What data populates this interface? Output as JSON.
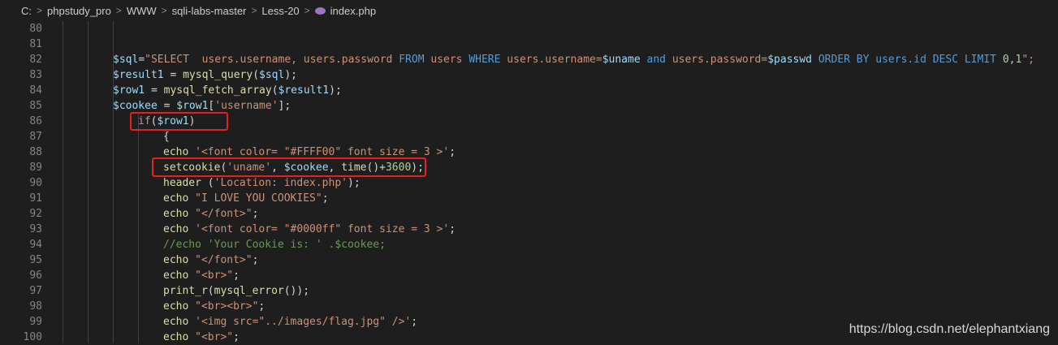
{
  "breadcrumb": [
    "C:",
    "phpstudy_pro",
    "WWW",
    "sqli-labs-master",
    "Less-20",
    "index.php"
  ],
  "icons": {
    "separator": "chevron-right-icon",
    "file": "php-elephant-icon"
  },
  "line_numbers": [
    "80",
    "81",
    "82",
    "83",
    "84",
    "85",
    "86",
    "87",
    "88",
    "89",
    "90",
    "91",
    "92",
    "93",
    "94",
    "95",
    "96",
    "97",
    "98",
    "99",
    "100"
  ],
  "code": {
    "l82": {
      "a": "$sql",
      "b": "=",
      "c": "\"SELECT  users.username, users.password ",
      "d": "FROM",
      "e": " users ",
      "f": "WHERE",
      "g": " users.username=",
      "h": "$uname",
      "i": " and ",
      "j": "users.password=",
      "k": "$passwd",
      "l": " ORDER BY users.id DESC LIMIT ",
      "m": "0,1",
      "n": "\";"
    },
    "l83": {
      "a": "$result1",
      "b": " = ",
      "c": "mysql_query",
      "d": "(",
      "e": "$sql",
      "f": ");"
    },
    "l84": {
      "a": "$row1",
      "b": " = ",
      "c": "mysql_fetch_array",
      "d": "(",
      "e": "$result1",
      "f": ");"
    },
    "l85": {
      "a": "$cookee",
      "b": " = ",
      "c": "$row1",
      "d": "[",
      "e": "'username'",
      "f": "];"
    },
    "l86": {
      "a": "if",
      "b": "(",
      "c": "$row1",
      "d": ")"
    },
    "l87": {
      "a": "{"
    },
    "l88": {
      "a": "echo ",
      "b": "'<font color= \"#FFFF00\" font size = 3 >'",
      "c": ";"
    },
    "l89": {
      "a": "setcookie",
      "b": "(",
      "c": "'uname'",
      "d": ", ",
      "e": "$cookee",
      "f": ", ",
      "g": "time",
      "h": "()+",
      "i": "3600",
      "j": ");"
    },
    "l90": {
      "a": "header ",
      "b": "(",
      "c": "'Location: index.php'",
      "d": ");"
    },
    "l91": {
      "a": "echo ",
      "b": "\"I LOVE YOU COOKIES\"",
      "c": ";"
    },
    "l92": {
      "a": "echo ",
      "b": "\"</font>\"",
      "c": ";"
    },
    "l93": {
      "a": "echo ",
      "b": "'<font color= \"#0000ff\" font size = 3 >'",
      "c": ";"
    },
    "l94": {
      "a": "//echo 'Your Cookie is: ' .$cookee;"
    },
    "l95": {
      "a": "echo ",
      "b": "\"</font>\"",
      "c": ";"
    },
    "l96": {
      "a": "echo ",
      "b": "\"<br>\"",
      "c": ";"
    },
    "l97": {
      "a": "print_r",
      "b": "(",
      "c": "mysql_error",
      "d": "());"
    },
    "l98": {
      "a": "echo ",
      "b": "\"<br><br>\"",
      "c": ";"
    },
    "l99": {
      "a": "echo ",
      "b": "'<img src=\"../images/flag.jpg\" />'",
      "c": ";"
    },
    "l100": {
      "a": "echo ",
      "b": "\"<br>\"",
      "c": ";"
    }
  },
  "watermark": "https://blog.csdn.net/elephantxiang",
  "colors": {
    "background": "#1e1e1e",
    "highlight_box": "#e3211f",
    "variable": "#9cdcfe",
    "string": "#ce9178",
    "keyword": "#569cd6",
    "function": "#dcdcaa",
    "comment": "#6a9955",
    "control": "#c586c0"
  }
}
